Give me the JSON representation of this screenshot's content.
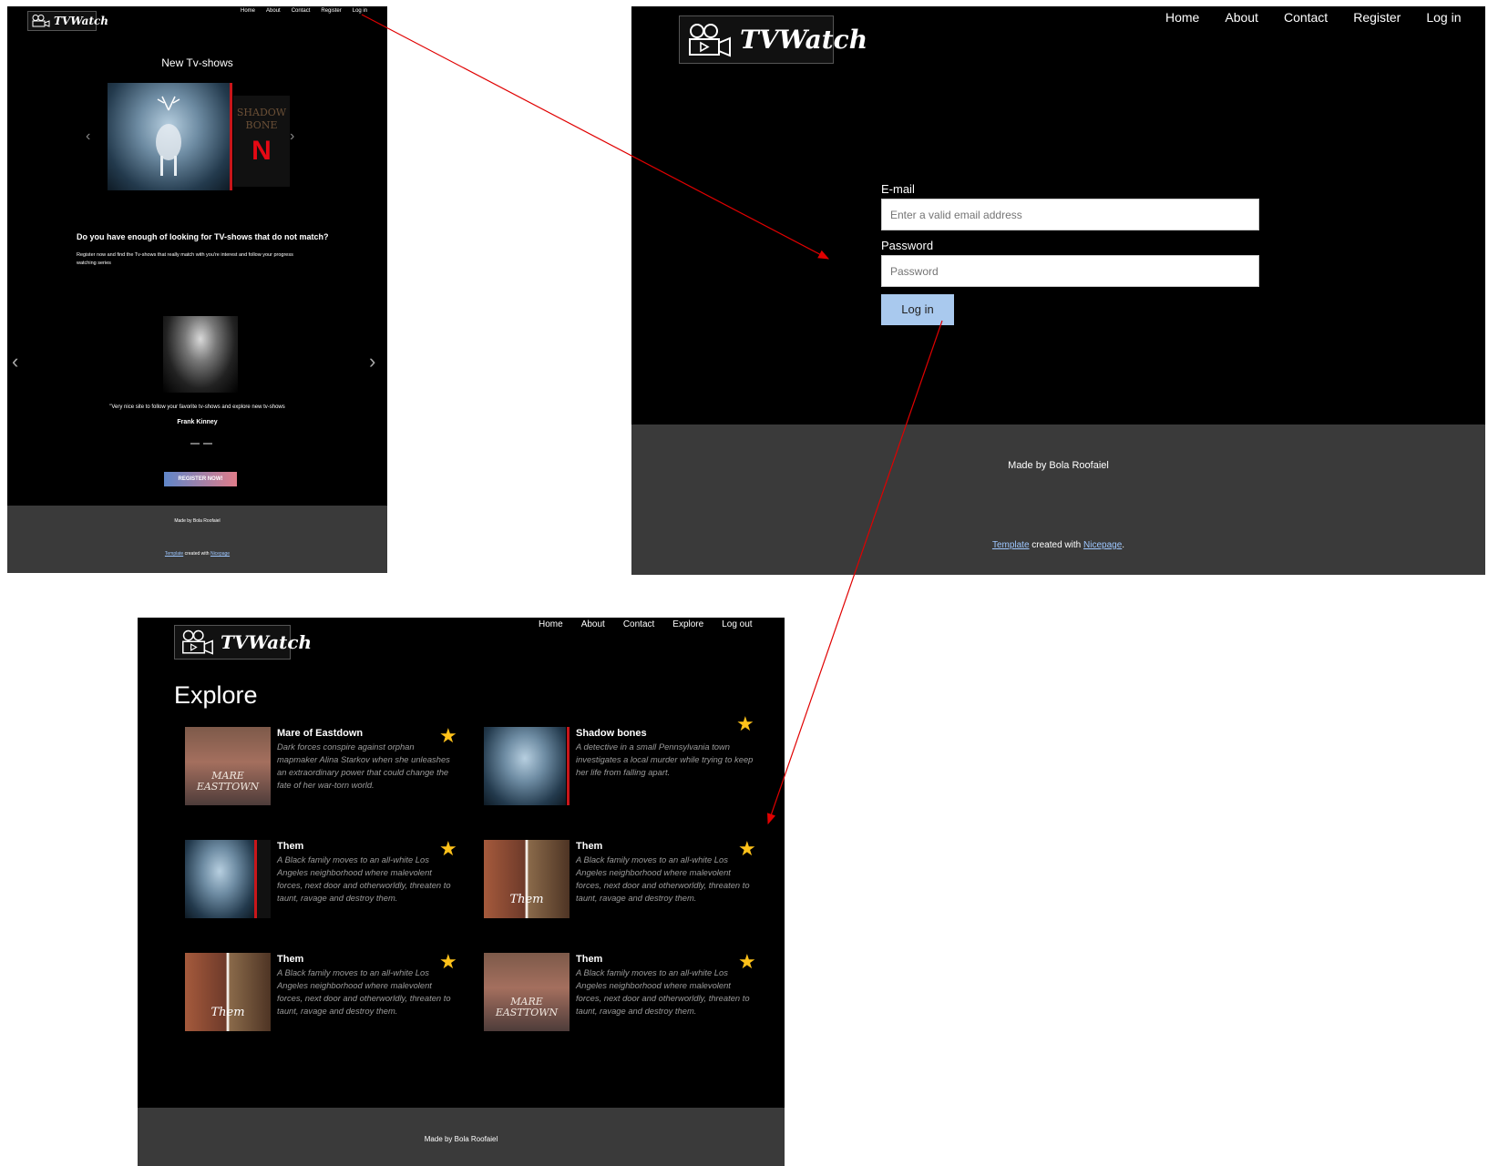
{
  "home": {
    "logo_text": "TVWatch",
    "nav": [
      "Home",
      "About",
      "Contact",
      "Register",
      "Log in"
    ],
    "carousel_title": "New Tv-shows",
    "headline": "Do you have enough of looking for TV-shows that do not match?",
    "subtext": "Register now and find the Tv-shows that really match with you're interest and follow your progress watching series",
    "testimonial_quote": "\"Very nice site to follow your favorite tv-shows and explore new tv-shows",
    "testimonial_name": "Frank Kinney",
    "register_button": "REGISTER NOW!",
    "footer_made_by": "Made by Bola Roofaiel",
    "footer_template": "Template",
    "footer_created_with": " created with ",
    "footer_nicepage": "Nicepage",
    "poster_text": "SHADOW BONE",
    "poster_brand": "N"
  },
  "login": {
    "logo_text": "TVWatch",
    "nav": [
      "Home",
      "About",
      "Contact",
      "Register",
      "Log in"
    ],
    "email_label": "E-mail",
    "email_placeholder": "Enter a valid email address",
    "password_label": "Password",
    "password_placeholder": "Password",
    "login_button": "Log in",
    "footer_made_by": "Made by Bola Roofaiel",
    "footer_template": "Template",
    "footer_created_with": " created with ",
    "footer_nicepage": "Nicepage",
    "footer_period": "."
  },
  "explore": {
    "logo_text": "TVWatch",
    "nav": [
      "Home",
      "About",
      "Contact",
      "Explore",
      "Log out"
    ],
    "title": "Explore",
    "cards": [
      {
        "title": "Mare of Eastdown",
        "desc": "Dark forces conspire against orphan mapmaker Alina Starkov when she unleashes an extraordinary power that could change the fate of her war-torn world.",
        "poster": "mare",
        "poster_text": "MARE EASTTOWN"
      },
      {
        "title": "Shadow bones",
        "desc": "A detective in a small Pennsylvania town investigates a local murder while trying to keep her life from falling apart.",
        "poster": "shadow",
        "poster_text": ""
      },
      {
        "title": "Them",
        "desc": "A Black family moves to an all-white Los Angeles neighborhood where malevolent forces, next door and otherworldly, threaten to taunt, ravage and destroy them.",
        "poster": "shadow2",
        "poster_text": ""
      },
      {
        "title": "Them",
        "desc": "A Black family moves to an all-white Los Angeles neighborhood where malevolent forces, next door and otherworldly, threaten to taunt, ravage and destroy them.",
        "poster": "them",
        "poster_text": "Them"
      },
      {
        "title": "Them",
        "desc": "A Black family moves to an all-white Los Angeles neighborhood where malevolent forces, next door and otherworldly, threaten to taunt, ravage and destroy them.",
        "poster": "them",
        "poster_text": "Them"
      },
      {
        "title": "Them",
        "desc": "A Black family moves to an all-white Los Angeles neighborhood where malevolent forces, next door and otherworldly, threaten to taunt, ravage and destroy them.",
        "poster": "mare",
        "poster_text": "MARE EASTTOWN"
      }
    ],
    "footer_made_by": "Made by Bola Roofaiel"
  },
  "colors": {
    "arrow": "#e00000",
    "footer": "#3a3a3a",
    "accent_button": "#a9c9ee",
    "star": "#ffc21a"
  }
}
